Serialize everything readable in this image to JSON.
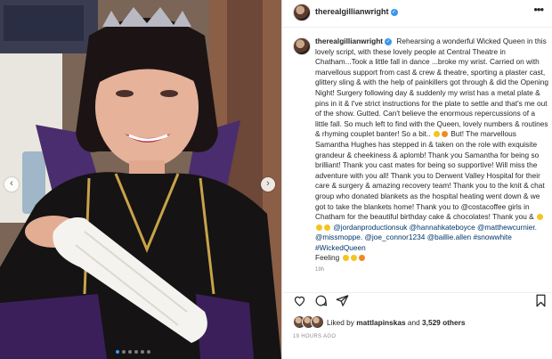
{
  "post": {
    "username": "therealgillianwright",
    "verified_mark": "✓",
    "more": "•••",
    "caption": "Rehearsing a wonderful Wicked Queen in this lovely script, with these lovely people at Central Theatre in Chatham...Took a little fall in dance ...broke my wrist. Carried on with marvellous support from cast & crew & theatre, sporting a plaster cast, glittery sling & with the help of painkillers got through & did the Opening Night! Surgery following day & suddenly my wrist has a metal plate & pins in it & I've strict instructions for the plate to settle and that's me out of the show. Gutted. Can't believe the enormous repercussions of a little fall. So much left to find with the Queen, lovely numbers & routines & rhyming couplet banter! So a bit..",
    "caption_2": "But! The marvellous Samantha Hughes has stepped in & taken on the role with exquisite grandeur & cheekiness & aplomb! Thank you Samantha for being so brilliant! Thank you cast mates for being so supportive! Will miss the adventure with you all! Thank you to Derwent Valley Hospital for their care & surgery & amazing recovery team! Thank you to the knit & chat group who donated blankets as the hospital heating went down & we got to take the blankets home! Thank you to @costacoffee girls in Chatham for the beautiful birthday cake & chocolates! Thank you &",
    "caption_3": "@jordanproductionsuk @hannahkateboyce @matthewcurnier. @missmoppe. @joe_connor1234 @baillie.allen #snowwhite #WickedQueen",
    "caption_4": "Feeling",
    "scroll_hint": "19h",
    "likes_prefix": "Liked by",
    "liked_by_user": "mattlapinskas",
    "likes_and": "and",
    "likes_others": "3,529 others",
    "timestamp": "19 HOURS AGO"
  },
  "carousel": {
    "prev": "‹",
    "next": "›",
    "slides": 6,
    "active": 0
  },
  "icons": {
    "like": "heart-icon",
    "comment": "comment-icon",
    "share": "paper-plane-icon",
    "save": "bookmark-icon"
  },
  "colors": {
    "accent": "#3897f0",
    "text": "#262626",
    "muted": "#8e8e8e"
  }
}
